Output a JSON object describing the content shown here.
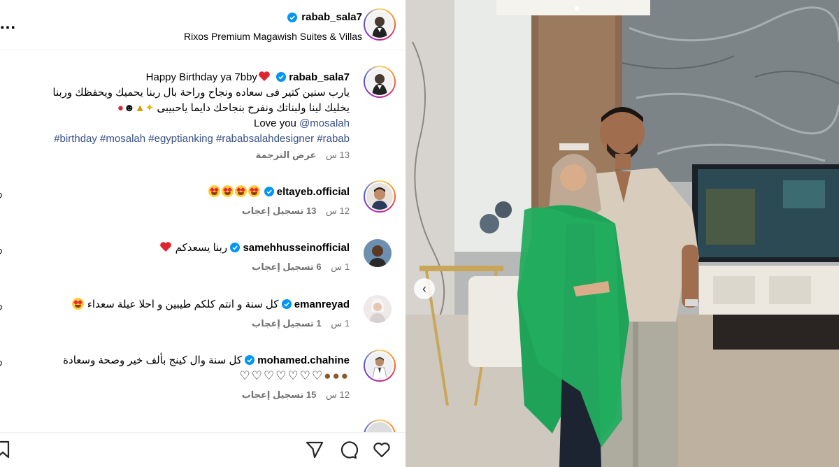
{
  "header": {
    "username": "rabab_sala7",
    "location": "Rixos Premium Magawish Suites & Villas",
    "more_label": "..."
  },
  "caption": {
    "username": "rabab_sala7",
    "title": "Happy Birthday ya 7bby",
    "line1": "يارب سنين كتير فى سعاده ونجاح وراحة بال ربنا يحميك ويحفظك وربنا",
    "line2": "يخليك لينا ولبناتك ونفرح بنجاحك دايما ياحبيبى",
    "love": "Love you",
    "mention": "@mosalah",
    "hashtags": "#birthday #mosalah #egyptianking #rababsalahdesigner #rabab",
    "time": "13 س",
    "translate": "عرض الترجمة"
  },
  "comments": [
    {
      "username": "eltayeb.official",
      "text": "",
      "time": "12 س",
      "likes": "13 تسجيل إعجاب"
    },
    {
      "username": "samehhusseinofficial",
      "text": "ربنا يسعدكم",
      "time": "1 س",
      "likes": "6 تسجيل إعجاب"
    },
    {
      "username": "emanreyad",
      "text": "كل سنة و انتم كلكم طيبين و احلا عيلة سعداء",
      "time": "1 س",
      "likes": "1 تسجيل إعجاب"
    },
    {
      "username": "mohamed.chahine",
      "text": "كل سنة وال كينج بألف خير وصحة وسعادة",
      "time": "12 س",
      "likes": "15 تسجيل إعجاب"
    }
  ],
  "icons": [
    "more-icon",
    "verified-icon",
    "heart-icon",
    "comment-icon",
    "share-icon",
    "bookmark-icon",
    "chevron-left-icon"
  ],
  "colors": {
    "link": "#385185",
    "muted": "#737373",
    "verified": "#0095f6",
    "dress": "#1fa358"
  }
}
